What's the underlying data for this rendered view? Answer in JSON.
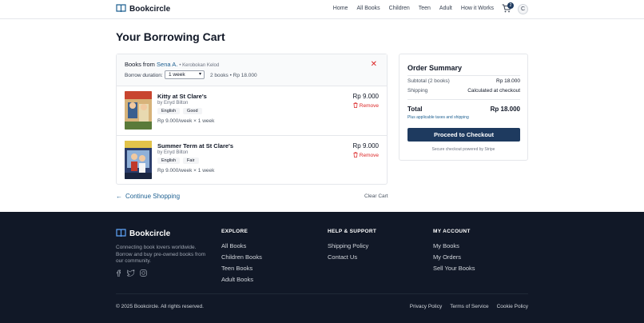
{
  "header": {
    "brand": "Bookcircle",
    "nav": [
      "Home",
      "All Books",
      "Children",
      "Teen",
      "Adult",
      "How it Works"
    ],
    "cart_count": "2",
    "avatar_initial": "C"
  },
  "page_title": "Your Borrowing Cart",
  "cart": {
    "from_label": "Books from",
    "owner": "Sena A.",
    "location": "• Kerobokan Kelod",
    "duration_label": "Borrow duration:",
    "duration_value": "1 week",
    "meta": "2 books • Rp 18.000",
    "items": [
      {
        "title": "Kitty at St Clare's",
        "author": "by Enyd Bilton",
        "tags": [
          "English",
          "Good"
        ],
        "rate": "Rp 9.000/week × 1 week",
        "price": "Rp 9.000",
        "remove": "Remove"
      },
      {
        "title": "Summer Term at St Clare's",
        "author": "by Enyd Bilton",
        "tags": [
          "English",
          "Fair"
        ],
        "rate": "Rp 9.000/week × 1 week",
        "price": "Rp 9.000",
        "remove": "Remove"
      }
    ],
    "continue": "Continue Shopping",
    "clear": "Clear Cart"
  },
  "summary": {
    "title": "Order Summary",
    "subtotal_label": "Subtotal (2 books)",
    "subtotal_value": "Rp 18.000",
    "shipping_label": "Shipping",
    "shipping_value": "Calculated at checkout",
    "total_label": "Total",
    "total_value": "Rp 18.000",
    "note": "Plus applicable taxes and shipping",
    "checkout": "Proceed to Checkout",
    "secure": "Secure checkout powered by Stripe"
  },
  "footer": {
    "brand": "Bookcircle",
    "desc": "Connecting book lovers worldwide. Borrow and buy pre-owned books from our community.",
    "cols": [
      {
        "title": "EXPLORE",
        "links": [
          "All Books",
          "Children Books",
          "Teen Books",
          "Adult Books"
        ]
      },
      {
        "title": "HELP & SUPPORT",
        "links": [
          "Shipping Policy",
          "Contact Us"
        ]
      },
      {
        "title": "MY ACCOUNT",
        "links": [
          "My Books",
          "My Orders",
          "Sell Your Books"
        ]
      }
    ],
    "copyright": "© 2025 Bookcircle. All rights reserved.",
    "legal": [
      "Privacy Policy",
      "Terms of Service",
      "Cookie Policy"
    ]
  },
  "colors": {
    "primary": "#1e3a5f",
    "link": "#1e6091",
    "danger": "#dc2626",
    "footer_bg": "#111827"
  }
}
